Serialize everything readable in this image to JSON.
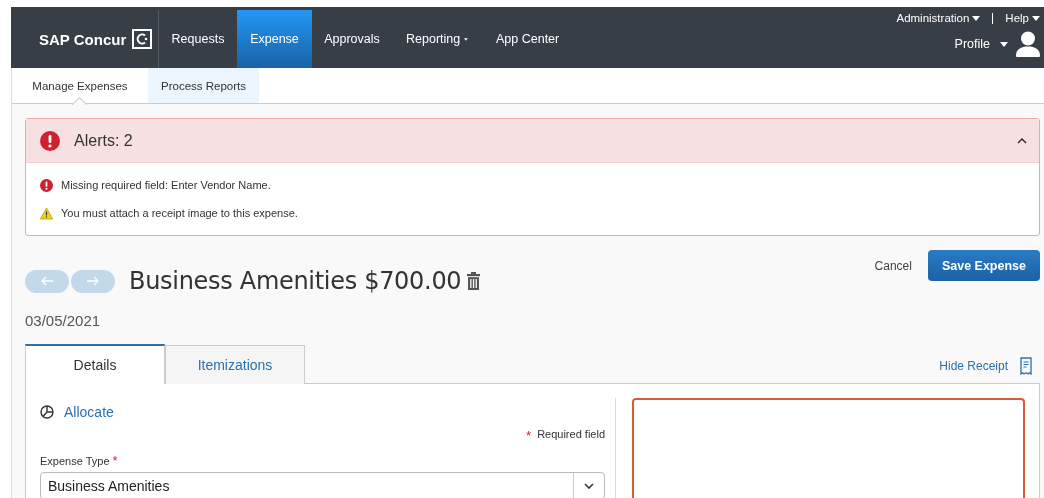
{
  "header": {
    "brand": "SAP Concur",
    "nav": [
      {
        "label": "Requests",
        "selected": false,
        "dropdown": false
      },
      {
        "label": "Expense",
        "selected": true,
        "dropdown": false
      },
      {
        "label": "Approvals",
        "selected": false,
        "dropdown": false
      },
      {
        "label": "Reporting",
        "selected": false,
        "dropdown": true
      },
      {
        "label": "App Center",
        "selected": false,
        "dropdown": false
      }
    ],
    "utility_links": [
      {
        "label": "Administration"
      },
      {
        "label": "Help"
      }
    ],
    "profile": {
      "label": "Profile"
    }
  },
  "subnav": [
    {
      "label": "Manage Expenses",
      "selected": true
    },
    {
      "label": "Process Reports",
      "selected": false
    }
  ],
  "alerts": {
    "title": "Alerts: 2",
    "expanded": true,
    "items": [
      {
        "kind": "error",
        "text": "Missing required field: Enter Vendor Name."
      },
      {
        "kind": "warning",
        "text": "You must attach a receipt image to this expense."
      }
    ]
  },
  "expense": {
    "title": "Business Amenities $700.00",
    "date": "03/05/2021",
    "cancel": "Cancel",
    "save": "Save Expense"
  },
  "tabs": [
    {
      "label": "Details",
      "selected": true
    },
    {
      "label": "Itemizations",
      "selected": false
    }
  ],
  "hide_receipt": "Hide Receipt",
  "form": {
    "allocate": "Allocate",
    "required_legend": {
      "mark": "*",
      "text": "Required field"
    },
    "fields": [
      {
        "label": "Expense Type",
        "required_mark": "*",
        "value": "Business Amenities"
      }
    ]
  }
}
